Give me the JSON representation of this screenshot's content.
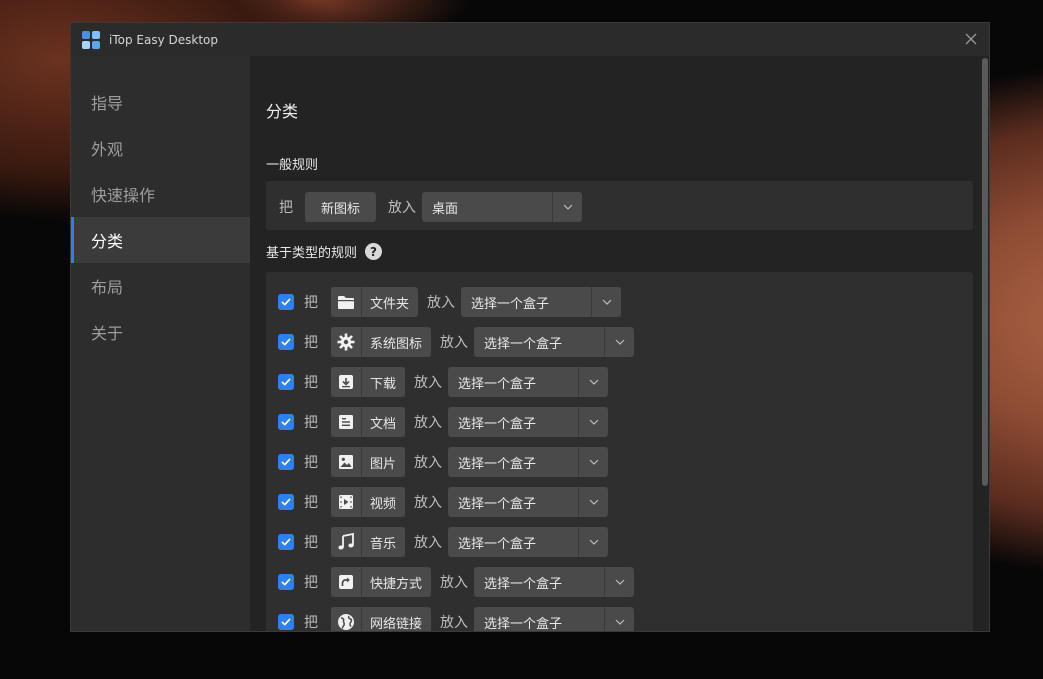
{
  "window": {
    "title": "iTop Easy Desktop",
    "close_glyph": "✕"
  },
  "sidebar": {
    "items": [
      {
        "label": "指导",
        "active": false
      },
      {
        "label": "外观",
        "active": false
      },
      {
        "label": "快速操作",
        "active": false
      },
      {
        "label": "分类",
        "active": true
      },
      {
        "label": "布局",
        "active": false
      },
      {
        "label": "关于",
        "active": false
      }
    ]
  },
  "content": {
    "title": "分类",
    "general": {
      "heading": "一般规则",
      "put_word": "把",
      "item_label": "新图标",
      "into_word": "放入",
      "target": "桌面"
    },
    "type_rules": {
      "heading": "基于类型的规则",
      "help_glyph": "?",
      "rules": [
        {
          "checked": true,
          "put_word": "把",
          "icon": "folder-icon",
          "label": "文件夹",
          "into_word": "放入",
          "target": "选择一个盒子"
        },
        {
          "checked": true,
          "put_word": "把",
          "icon": "gear-icon",
          "label": "系统图标",
          "into_word": "放入",
          "target": "选择一个盒子"
        },
        {
          "checked": true,
          "put_word": "把",
          "icon": "download-icon",
          "label": "下载",
          "into_word": "放入",
          "target": "选择一个盒子"
        },
        {
          "checked": true,
          "put_word": "把",
          "icon": "document-icon",
          "label": "文档",
          "into_word": "放入",
          "target": "选择一个盒子"
        },
        {
          "checked": true,
          "put_word": "把",
          "icon": "image-icon",
          "label": "图片",
          "into_word": "放入",
          "target": "选择一个盒子"
        },
        {
          "checked": true,
          "put_word": "把",
          "icon": "video-icon",
          "label": "视频",
          "into_word": "放入",
          "target": "选择一个盒子"
        },
        {
          "checked": true,
          "put_word": "把",
          "icon": "music-icon",
          "label": "音乐",
          "into_word": "放入",
          "target": "选择一个盒子"
        },
        {
          "checked": true,
          "put_word": "把",
          "icon": "shortcut-icon",
          "label": "快捷方式",
          "into_word": "放入",
          "target": "选择一个盒子"
        },
        {
          "checked": true,
          "put_word": "把",
          "icon": "globe-icon",
          "label": "网络链接",
          "into_word": "放入",
          "target": "选择一个盒子"
        }
      ]
    }
  },
  "colors": {
    "accent": "#2f80ed",
    "window_bg": "#232323",
    "sidebar_bg": "#2d2d2d",
    "control_bg": "#4a4a4a"
  }
}
